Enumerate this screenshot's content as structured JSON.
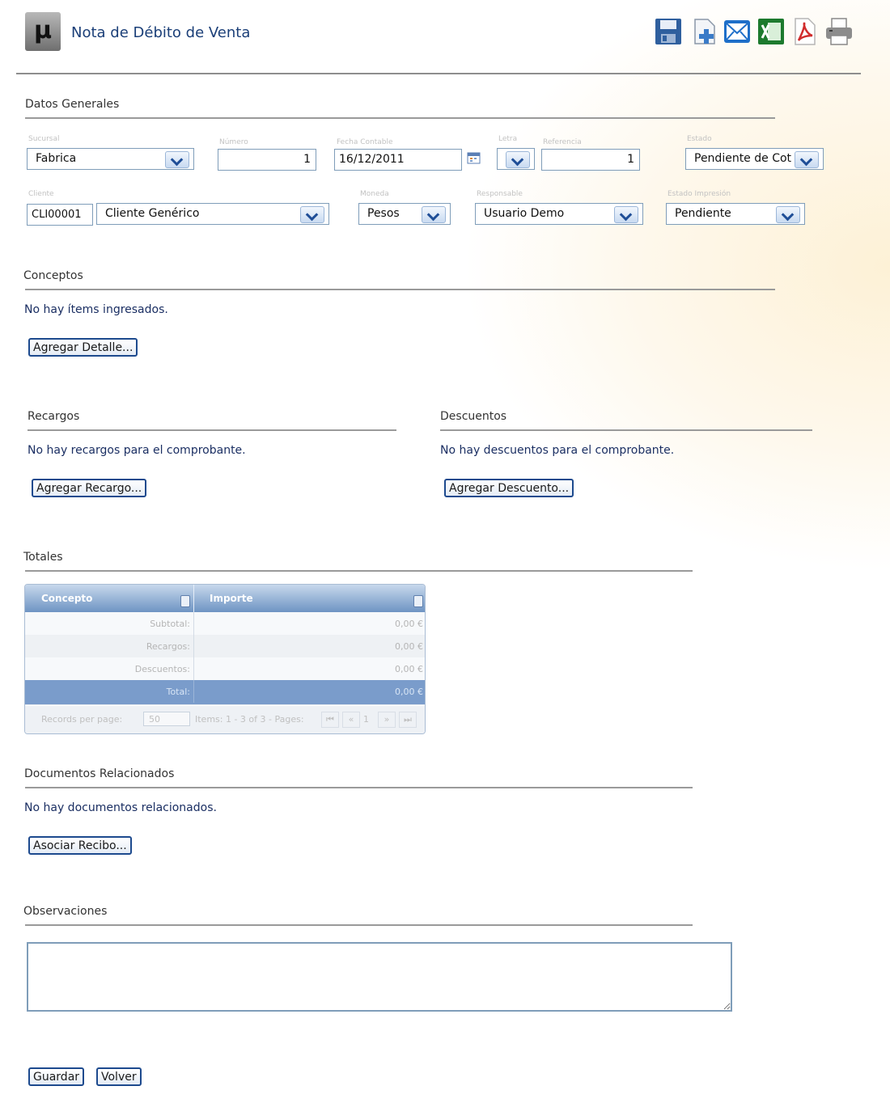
{
  "header": {
    "title": "Nota de Débito de Venta",
    "logo_glyph": "µ",
    "toolbar": [
      {
        "name": "save-icon",
        "color": "#2f5f9e"
      },
      {
        "name": "new-document-icon",
        "color": "#3a7bc8"
      },
      {
        "name": "email-icon",
        "color": "#1e6fc9"
      },
      {
        "name": "excel-icon",
        "color": "#1d7a2e"
      },
      {
        "name": "pdf-icon",
        "color": "#d12c2c"
      },
      {
        "name": "print-icon",
        "color": "#666666"
      }
    ]
  },
  "datos_generales": {
    "title": "Datos Generales",
    "sucursal": {
      "label": "Sucursal",
      "value": "Fabrica"
    },
    "numero": {
      "label": "Número",
      "value": "1"
    },
    "fecha": {
      "label": "Fecha Contable",
      "value": "16/12/2011"
    },
    "letra": {
      "label": "Letra",
      "value": ""
    },
    "referencia": {
      "label": "Referencia",
      "value": "1"
    },
    "estado": {
      "label": "Estado",
      "value": "Pendiente de Cot"
    },
    "cliente": {
      "label": "Cliente",
      "code": "CLI00001",
      "value": "Cliente Genérico"
    },
    "moneda": {
      "label": "Moneda",
      "value": "Pesos"
    },
    "responsable": {
      "label": "Responsable",
      "value": "Usuario Demo"
    },
    "estado_impresion": {
      "label": "Estado Impresión",
      "value": "Pendiente"
    }
  },
  "conceptos": {
    "title": "Conceptos",
    "empty": "No hay ítems ingresados.",
    "button": "Agregar Detalle..."
  },
  "recargos": {
    "title": "Recargos",
    "empty": "No hay recargos para el comprobante.",
    "button": "Agregar Recargo..."
  },
  "descuentos": {
    "title": "Descuentos",
    "empty": "No hay descuentos para el comprobante.",
    "button": "Agregar Descuento..."
  },
  "totales": {
    "title": "Totales",
    "columns": [
      "Concepto",
      "Importe"
    ],
    "rows": [
      {
        "concepto": "Subtotal:",
        "importe": "0,00 €"
      },
      {
        "concepto": "Recargos:",
        "importe": "0,00 €"
      },
      {
        "concepto": "Descuentos:",
        "importe": "0,00 €"
      },
      {
        "concepto": "Total:",
        "importe": "0,00 €"
      }
    ],
    "footer": {
      "records_label": "Records per page:",
      "records_value": "50",
      "range": "Items: 1 - 3 of 3 - Pages:",
      "first": "⏮",
      "prev": "«",
      "page": "1",
      "next": "»",
      "last": "⏭"
    }
  },
  "documentos": {
    "title": "Documentos Relacionados",
    "empty": "No hay documentos relacionados.",
    "button": "Asociar Recibo..."
  },
  "observaciones": {
    "title": "Observaciones",
    "value": ""
  },
  "actions": {
    "guardar": "Guardar",
    "volver": "Volver"
  }
}
